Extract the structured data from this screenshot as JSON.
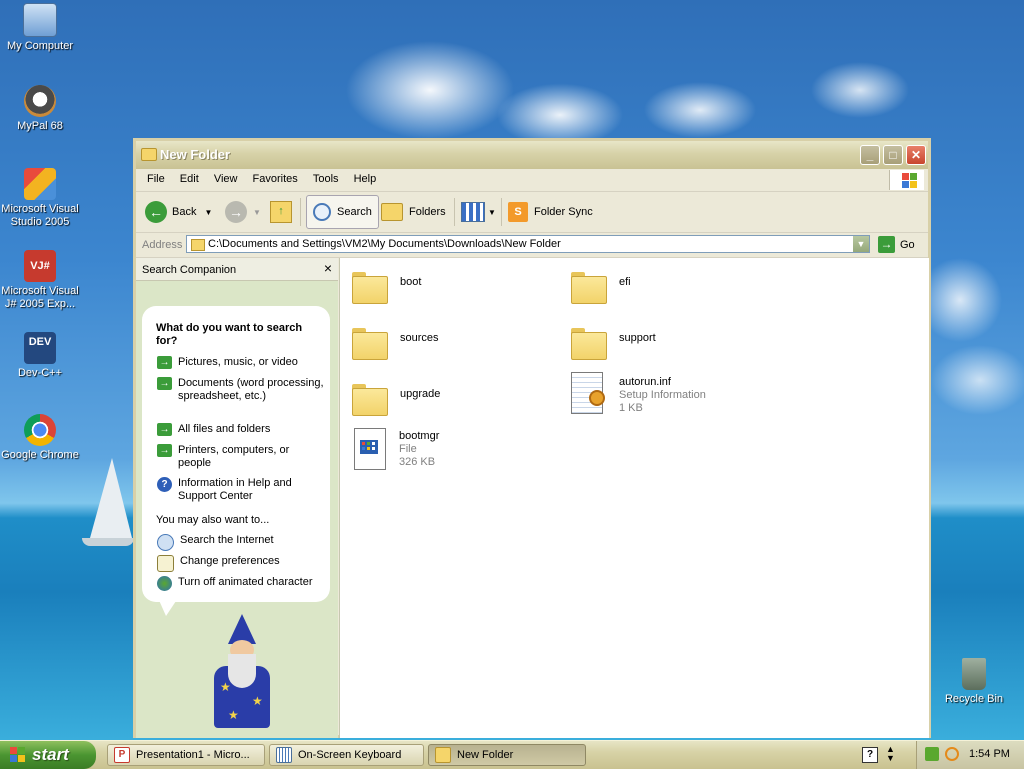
{
  "desktop": {
    "icons": [
      {
        "label": "My Computer",
        "icon": "my-computer-icon"
      },
      {
        "label": "MyPal 68",
        "icon": "mypal-icon"
      },
      {
        "label": "Microsoft Visual Studio 2005",
        "icon": "visual-studio-icon"
      },
      {
        "label": "Microsoft Visual J# 2005 Exp...",
        "icon": "visual-jsharp-icon"
      },
      {
        "label": "Dev-C++",
        "icon": "dev-cpp-icon"
      },
      {
        "label": "Google Chrome",
        "icon": "chrome-icon"
      },
      {
        "label": "Recycle Bin",
        "icon": "recycle-bin-icon"
      }
    ],
    "devcpp_badge": "DEV",
    "vj_badge": "VJ#"
  },
  "window": {
    "title": "New Folder",
    "menu": [
      "File",
      "Edit",
      "View",
      "Favorites",
      "Tools",
      "Help"
    ],
    "toolbar": {
      "back": "Back",
      "search": "Search",
      "folders": "Folders",
      "folder_sync": "Folder Sync"
    },
    "address": {
      "label": "Address",
      "value": "C:\\Documents and Settings\\VM2\\My Documents\\Downloads\\New Folder",
      "go": "Go"
    }
  },
  "companion": {
    "title": "Search Companion",
    "close": "×",
    "question": "What do you want to search for?",
    "options": [
      "Pictures, music, or video",
      "Documents (word processing, spreadsheet, etc.)",
      "All files and folders",
      "Printers, computers, or people",
      "Information in Help and Support Center"
    ],
    "also_label": "You may also want to...",
    "also_options": [
      "Search the Internet",
      "Change preferences",
      "Turn off animated character"
    ]
  },
  "files": [
    {
      "name": "boot",
      "type": "folder"
    },
    {
      "name": "efi",
      "type": "folder"
    },
    {
      "name": "sources",
      "type": "folder"
    },
    {
      "name": "support",
      "type": "folder"
    },
    {
      "name": "upgrade",
      "type": "folder"
    },
    {
      "name": "autorun.inf",
      "type": "file",
      "kind": "Setup Information",
      "size": "1 KB"
    },
    {
      "name": "bootmgr",
      "type": "file",
      "kind": "File",
      "size": "326 KB"
    }
  ],
  "taskbar": {
    "start": "start",
    "tasks": [
      {
        "label": "Presentation1 - Micro...",
        "icon": "powerpoint-icon",
        "active": false
      },
      {
        "label": "On-Screen Keyboard",
        "icon": "keyboard-icon",
        "active": false
      },
      {
        "label": "New Folder",
        "icon": "folder-icon",
        "active": true
      }
    ],
    "clock": "1:54 PM"
  },
  "colors": {
    "title_bar": "#d7d2a8",
    "companion_bg": "#dbe6c7",
    "start_green": "#4b9531",
    "arrow_green": "#3b9c3a"
  }
}
